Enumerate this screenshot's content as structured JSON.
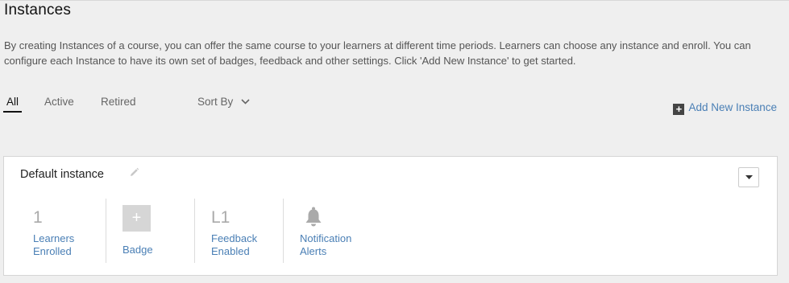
{
  "page": {
    "title": "Instances",
    "description": "By creating Instances of a course, you can offer the same course to your learners at different time periods. Learners can choose any instance and enroll. You can configure each Instance to have its own set of badges, feedback and other settings. Click 'Add New Instance' to get started."
  },
  "tabs": [
    {
      "label": "All",
      "active": true
    },
    {
      "label": "Active",
      "active": false
    },
    {
      "label": "Retired",
      "active": false
    }
  ],
  "sort": {
    "label": "Sort By"
  },
  "add_instance": {
    "label": "Add New Instance"
  },
  "instance": {
    "name": "Default instance",
    "stats": {
      "learners": {
        "value": "1",
        "line1": "Learners",
        "line2": "Enrolled"
      },
      "badge": {
        "symbol": "+",
        "label": "Badge"
      },
      "feedback": {
        "value": "L1",
        "line1": "Feedback",
        "line2": "Enabled"
      },
      "notification": {
        "line1": "Notification",
        "line2": "Alerts"
      }
    }
  },
  "icons": {
    "edit": "pencil-icon",
    "dropdown": "caret-down-icon",
    "sort": "chevron-down-icon",
    "add": "plus-square-icon",
    "notification": "bell-icon"
  },
  "colors": {
    "link": "#4a7fb5",
    "background": "#efefef",
    "muted_value": "#aaaaaa"
  }
}
